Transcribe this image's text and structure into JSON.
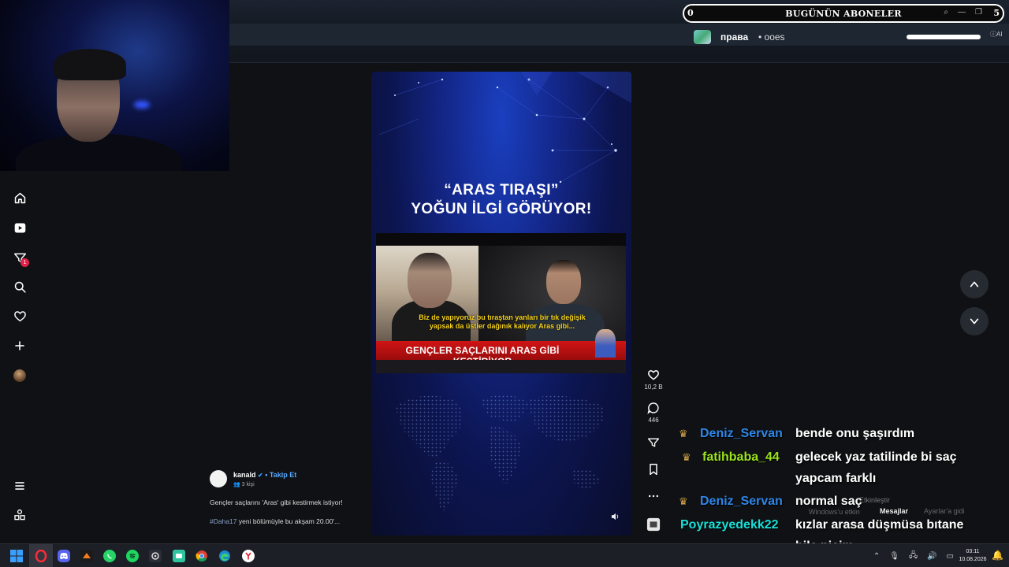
{
  "overlay": {
    "subs_count": "0",
    "subs_title": "BUGÜNÜN ABONELER",
    "subs_right": "5",
    "mini_text1": "права",
    "mini_text2": "• ооеѕ",
    "mini_ai": "ⓘAI"
  },
  "sidebar": {
    "items": [
      {
        "name": "home-icon",
        "glyph": "⌂"
      },
      {
        "name": "video-icon",
        "glyph": "▶"
      },
      {
        "name": "filter-icon",
        "glyph": "⛉",
        "badge": "1"
      },
      {
        "name": "search-icon",
        "glyph": "⌕"
      },
      {
        "name": "heart-icon",
        "glyph": "♡"
      },
      {
        "name": "add-icon",
        "glyph": "+"
      }
    ],
    "menu_glyph": "≡",
    "people_glyph": "⧉"
  },
  "video": {
    "headline_line1": "“ARAS TIRAŞI”",
    "headline_line2": "YOĞUN İLGİ GÖRÜYOR!",
    "caption_line1": "Biz de yapıyoruz bu tıraştan yanları bir tık değişik",
    "caption_line2": "yapsak da üstler dağınık kalıyor Aras gibi...",
    "banner": "GENÇLER SAÇLARINI ARAS GİBİ KESTİRİYOR",
    "volume_glyph": "🔊"
  },
  "actions": {
    "like_count": "10,2 B",
    "comment_count": "446"
  },
  "post": {
    "username": "kanald",
    "follow_label": "Takip Et",
    "viewers": "3 kişi",
    "description": "Gençler saçlarını 'Aras' gibi kestirmek istiyor!",
    "hashtag": "#Daha17",
    "tag_text": " yeni bölümüyle bu akşam 20.00'..."
  },
  "chat": [
    {
      "user": "Deniz_Servan",
      "color": "#2f86e8",
      "message": "bende onu şaşırdım"
    },
    {
      "user": "fatihbaba_44",
      "color": "#9be31c",
      "message": "gelecek yaz tatilinde bi saç",
      "message2": "yapcam farklı"
    },
    {
      "user": "Deniz_Servan",
      "color": "#2f86e8",
      "message": "normal saç"
    },
    {
      "user": "Poyrazyedekk22",
      "color": "#19e0d8",
      "message": "kızlar arasa düşmüsa bıtane",
      "message2": "bile piçim"
    }
  ],
  "windows_notice": {
    "activate": "Etkinleştir",
    "line": "Windows'u etkin",
    "messages_label": "Mesajlar",
    "settings": "Ayarlar'a gidi"
  },
  "taskbar": {
    "time": "03:11",
    "date": "10.08.2026"
  }
}
